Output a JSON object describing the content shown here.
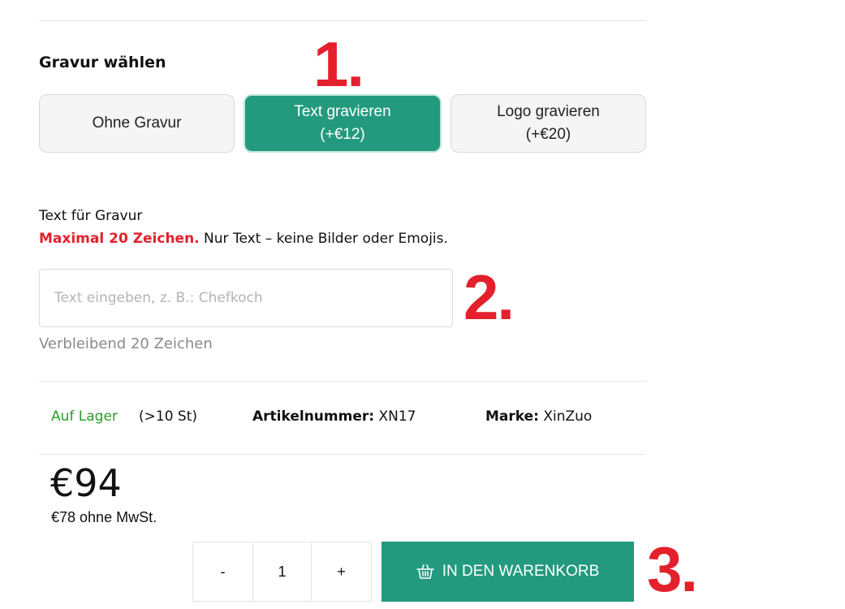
{
  "engraving": {
    "title": "Gravur wählen",
    "options": [
      {
        "label": "Ohne Gravur",
        "price": ""
      },
      {
        "label": "Text gravieren",
        "price": "(+€12)",
        "selected": true
      },
      {
        "label": "Logo gravieren",
        "price": "(+€20)"
      }
    ]
  },
  "text_field": {
    "label": "Text für Gravur",
    "hint_warning": "Maximal 20 Zeichen.",
    "hint_rest": " Nur Text – keine Bilder oder Emojis.",
    "placeholder": "Text eingeben, z. B.: Chefkoch",
    "value": "",
    "remaining": "Verbleibend 20 Zeichen"
  },
  "stock": {
    "status": "Auf Lager",
    "count": "(>10 St)"
  },
  "sku": {
    "label": "Artikelnummer:",
    "value": " XN17"
  },
  "brand": {
    "label": "Marke:",
    "value": " XinZuo"
  },
  "pricing": {
    "price": "€94",
    "net": "€78 ohne MwSt."
  },
  "quantity": {
    "minus": "-",
    "value": "1",
    "plus": "+"
  },
  "cart": {
    "label": "IN DEN WARENKORB",
    "icon": "basket-icon"
  },
  "annotations": [
    "1.",
    "2.",
    "3."
  ],
  "colors": {
    "accent": "#239a7e",
    "annotation": "#e3202c",
    "stock": "#2a9a2a"
  }
}
